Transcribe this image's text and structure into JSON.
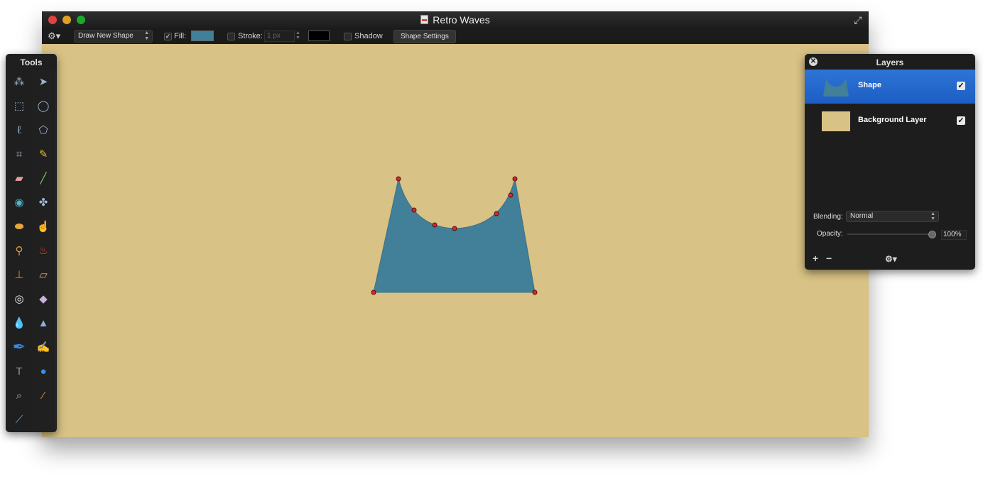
{
  "window": {
    "title": "Retro Waves"
  },
  "toolbar": {
    "mode_select": "Draw New Shape",
    "fill_checked": true,
    "fill_label": "Fill:",
    "fill_color": "#427f99",
    "stroke_checked": false,
    "stroke_label": "Stroke:",
    "stroke_width": "1 px",
    "stroke_color": "#000000",
    "shadow_checked": false,
    "shadow_label": "Shadow",
    "shape_settings_label": "Shape Settings"
  },
  "canvas": {
    "background_color": "#d8c285",
    "shape_color": "#427f99"
  },
  "tools_panel": {
    "title": "Tools",
    "tools": [
      [
        "magic-wand-icon",
        "move-icon"
      ],
      [
        "rect-select-icon",
        "ellipse-select-icon"
      ],
      [
        "lasso-icon",
        "polygon-lasso-icon"
      ],
      [
        "crop-icon",
        "pencil-icon"
      ],
      [
        "eraser-icon",
        "brush-icon"
      ],
      [
        "blur-icon",
        "smudge-icon"
      ],
      [
        "sponge-icon",
        "finger-icon"
      ],
      [
        "broom-icon",
        "burn-icon"
      ],
      [
        "stamp-icon",
        "bandage-icon"
      ],
      [
        "red-eye-icon",
        "eraser-block-icon"
      ],
      [
        "drop-icon",
        "cone-icon"
      ],
      [
        "pen-icon",
        "freeform-pen-icon"
      ],
      [
        "text-icon",
        "shape-icon"
      ],
      [
        "zoom-icon",
        "eyedropper-icon"
      ],
      [
        "line-icon",
        ""
      ]
    ]
  },
  "layers_panel": {
    "title": "Layers",
    "layers": [
      {
        "name": "Shape",
        "visible": true,
        "selected": true
      },
      {
        "name": "Background Layer",
        "visible": true,
        "selected": false
      }
    ],
    "blending_label": "Blending:",
    "blending_value": "Normal",
    "opacity_label": "Opacity:",
    "opacity_value": "100%",
    "opacity_fraction": 1.0
  }
}
